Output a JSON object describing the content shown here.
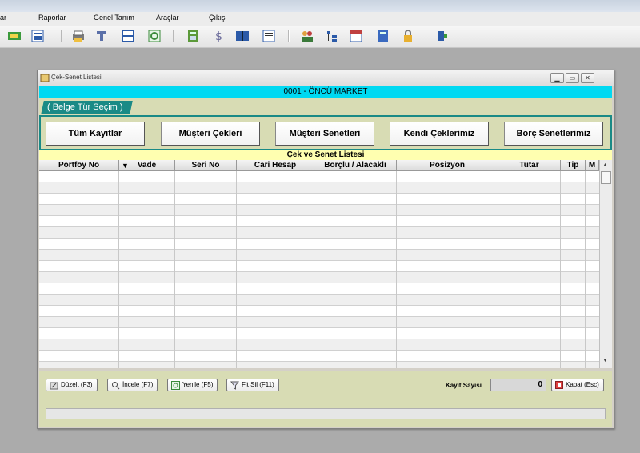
{
  "menu": {
    "items": [
      {
        "label": "ar"
      },
      {
        "label": "Raporlar"
      },
      {
        "label": "Genel Tanım"
      },
      {
        "label": "Araçlar"
      },
      {
        "label": "Çıkış"
      }
    ]
  },
  "toolbar": {
    "icons": [
      "money-icon",
      "list-icon",
      "print-icon",
      "filter-icon",
      "grid-icon",
      "refresh-icon",
      "calculator-icon",
      "dollar-icon",
      "book-icon",
      "report-icon",
      "users-icon",
      "tree-icon",
      "calendar-icon",
      "calc-icon",
      "lock-icon",
      "exit-icon"
    ]
  },
  "window": {
    "title": "Çek-Senet Listesi",
    "company": "0001 - ÖNCÜ MARKET",
    "tab_label": "( Belge Tür Seçim )",
    "category_buttons": [
      "Tüm Kayıtlar",
      "Müşteri Çekleri",
      "Müşteri Senetleri",
      "Kendi Çeklerimiz",
      "Borç Senetlerimiz"
    ],
    "list_title": "Çek ve Senet Listesi",
    "columns": [
      "Portföy No",
      "Vade",
      "Seri No",
      "Cari Hesap",
      "Borçlu / Alacaklı",
      "Posizyon",
      "Tutar",
      "Tip",
      "M"
    ],
    "sort_indicator": "▼",
    "actions": {
      "edit": "Düzelt (F3)",
      "inspect": "İncele (F7)",
      "refresh": "Yenile (F5)",
      "clear_filter": "Flt Sil (F11)",
      "close": "Kapat (Esc)"
    },
    "record_count_label": "Kayıt Sayısı",
    "record_count": "0"
  },
  "colors": {
    "company_bar": "#00d9f2",
    "tab": "#1a8a86",
    "panel": "#d8dcb4",
    "list_title": "#ffffb0"
  }
}
